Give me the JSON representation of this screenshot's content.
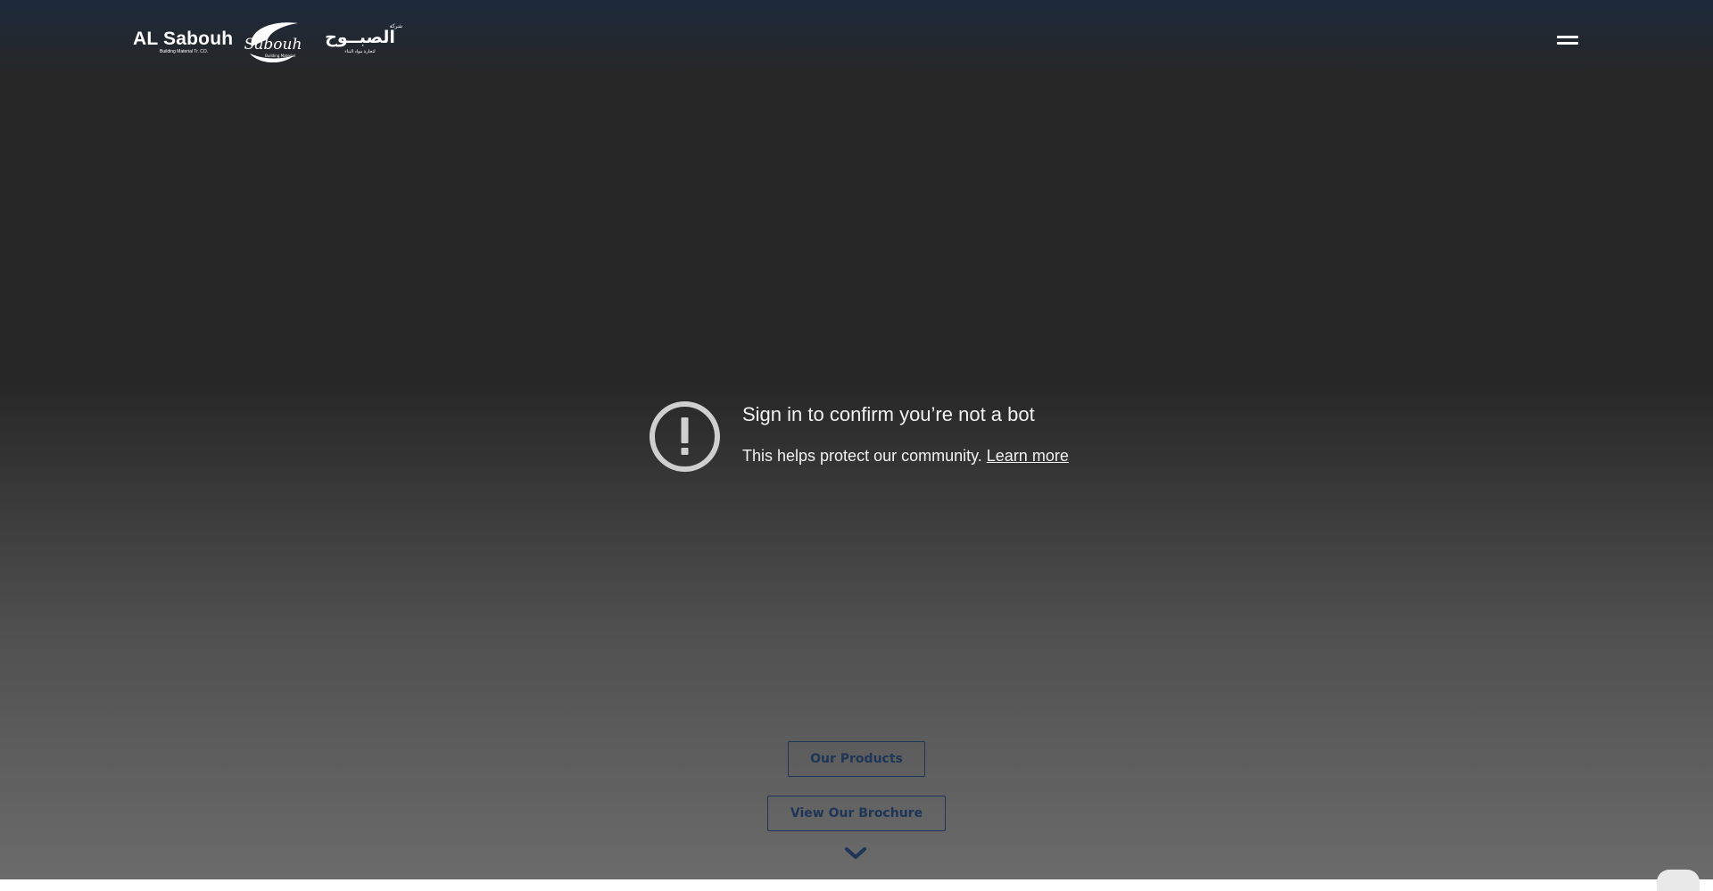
{
  "header": {
    "logo": {
      "name_en": "AL Sabouh",
      "subtitle_en": "Building Material Tr. CO.",
      "mark_script": "Sabouh",
      "mark_sub": "Building Material",
      "name_ar": "الصبــوح",
      "top_ar": "شركة",
      "subtitle_ar": "لتجارة مواد البناء"
    },
    "menu_icon": "hamburger-icon"
  },
  "notice": {
    "icon": "alert-circle-icon",
    "title": "Sign in to confirm you’re not a bot",
    "text": "This helps protect our community.",
    "link": "Learn more"
  },
  "actions": {
    "products_label": "Our Products",
    "brochure_label": "View Our Brochure",
    "scroll_icon": "chevron-down-icon"
  },
  "colors": {
    "accent": "#1d3557",
    "header_top": "#1c2a3c",
    "background_dark": "#272727",
    "background_light": "#6b6b6b",
    "text_light": "#f1f1f1"
  }
}
